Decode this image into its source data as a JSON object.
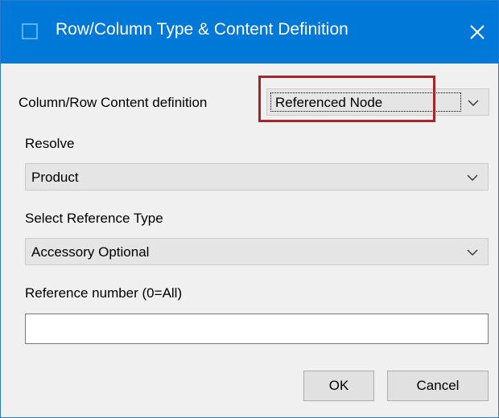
{
  "window": {
    "title": "Row/Column Type & Content Definition",
    "accent_color": "#0078d7",
    "highlight_color": "#a3262a",
    "icon": "window-icon",
    "close_icon": "close-icon"
  },
  "form": {
    "content_definition": {
      "label": "Column/Row Content definition",
      "value": "Referenced Node"
    },
    "resolve": {
      "label": "Resolve",
      "value": "Product"
    },
    "reference_type": {
      "label": "Select Reference Type",
      "value": "Accessory Optional"
    },
    "reference_number": {
      "label": "Reference number (0=All)",
      "value": ""
    }
  },
  "buttons": {
    "ok": "OK",
    "cancel": "Cancel"
  }
}
